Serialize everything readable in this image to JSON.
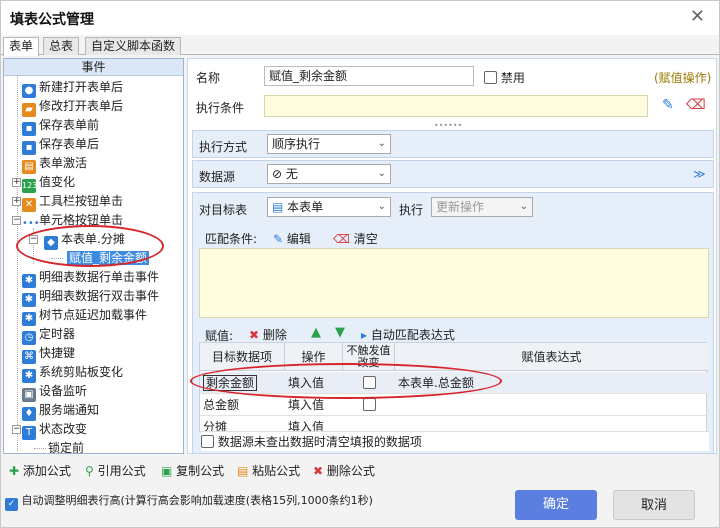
{
  "window": {
    "title": "填表公式管理",
    "close": "✕"
  },
  "tabs": [
    "表单",
    "总表",
    "自定义脚本函数"
  ],
  "left": {
    "header": "事件",
    "tree": [
      {
        "label": "新建打开表单后"
      },
      {
        "label": "修改打开表单后"
      },
      {
        "label": "保存表单前"
      },
      {
        "label": "保存表单后"
      },
      {
        "label": "表单激活"
      },
      {
        "label": "值变化"
      },
      {
        "label": "工具栏按钮单击"
      },
      {
        "label": "单元格按钮单击"
      },
      {
        "label": "本表单.分摊"
      },
      {
        "label": "赋值_剩余金额"
      },
      {
        "label": "明细表数据行单击事件"
      },
      {
        "label": "明细表数据行双击事件"
      },
      {
        "label": "树节点延迟加载事件"
      },
      {
        "label": "定时器"
      },
      {
        "label": "快捷键"
      },
      {
        "label": "系统剪贴板变化"
      },
      {
        "label": "设备监听"
      },
      {
        "label": "服务端通知"
      },
      {
        "label": "状态改变"
      },
      {
        "label": "锁定前"
      }
    ]
  },
  "right": {
    "name_label": "名称",
    "name_value": "赋值_剩余金额",
    "disable_label": "禁用",
    "op_type": "(赋值操作)",
    "cond_label": "执行条件",
    "exec_mode_label": "执行方式",
    "exec_mode_value": "顺序执行",
    "datasource_label": "数据源",
    "datasource_value": "无",
    "target_label": "对目标表",
    "target_value": "本表单",
    "exec_label": "执行",
    "exec_value": "更新操作",
    "match_label": "匹配条件:",
    "edit_label": "编辑",
    "clear_label": "清空",
    "assign_label": "赋值:",
    "delete_label": "删除",
    "auto_match_label": "自动匹配表达式",
    "grid_headers": [
      "目标数据项",
      "操作",
      "不触发值改变",
      "赋值表达式"
    ],
    "grid_rows": [
      {
        "target": "剩余金额",
        "op": "填入值",
        "expr": "本表单.总金额"
      },
      {
        "target": "总金额",
        "op": "填入值",
        "expr": ""
      },
      {
        "target": "分摊",
        "op": "填入值",
        "expr": ""
      }
    ],
    "clear_unfound_label": "数据源未查出数据时清空填报的数据项"
  },
  "bottom": {
    "add": "添加公式",
    "ref": "引用公式",
    "copy": "复制公式",
    "paste": "粘贴公式",
    "del": "删除公式",
    "auto_adjust": "自动调整明细表行高(计算行高会影响加载速度(表格15列,1000条约1秒)",
    "ok": "确定",
    "cancel": "取消"
  },
  "colors": {
    "accent": "#3d8be0",
    "ok_button": "#5b7fe0",
    "highlight": "#d7262b"
  }
}
